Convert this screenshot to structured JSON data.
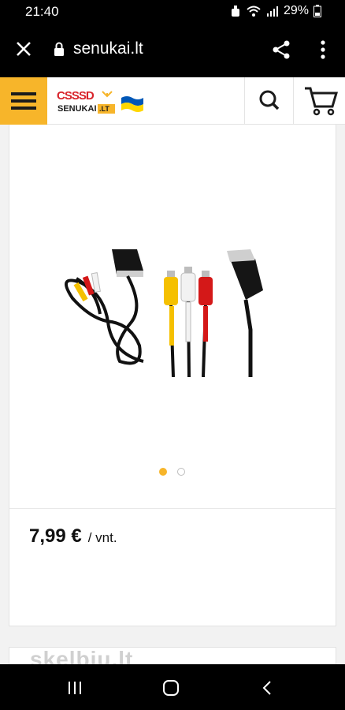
{
  "status_bar": {
    "time": "21:40",
    "battery": "29%"
  },
  "browser": {
    "url": "senukai.lt"
  },
  "header": {
    "logo_text": "SENUKAI.LT"
  },
  "product": {
    "price": "7,99 €",
    "unit": "/ vnt.",
    "active_image": 1,
    "image_count": 2
  },
  "watermark": {
    "text": "skelbiu.lt"
  },
  "colors": {
    "accent": "#f7b52a",
    "logo_red": "#d8232a",
    "flag_blue": "#0057b7",
    "flag_yellow": "#ffd700"
  }
}
